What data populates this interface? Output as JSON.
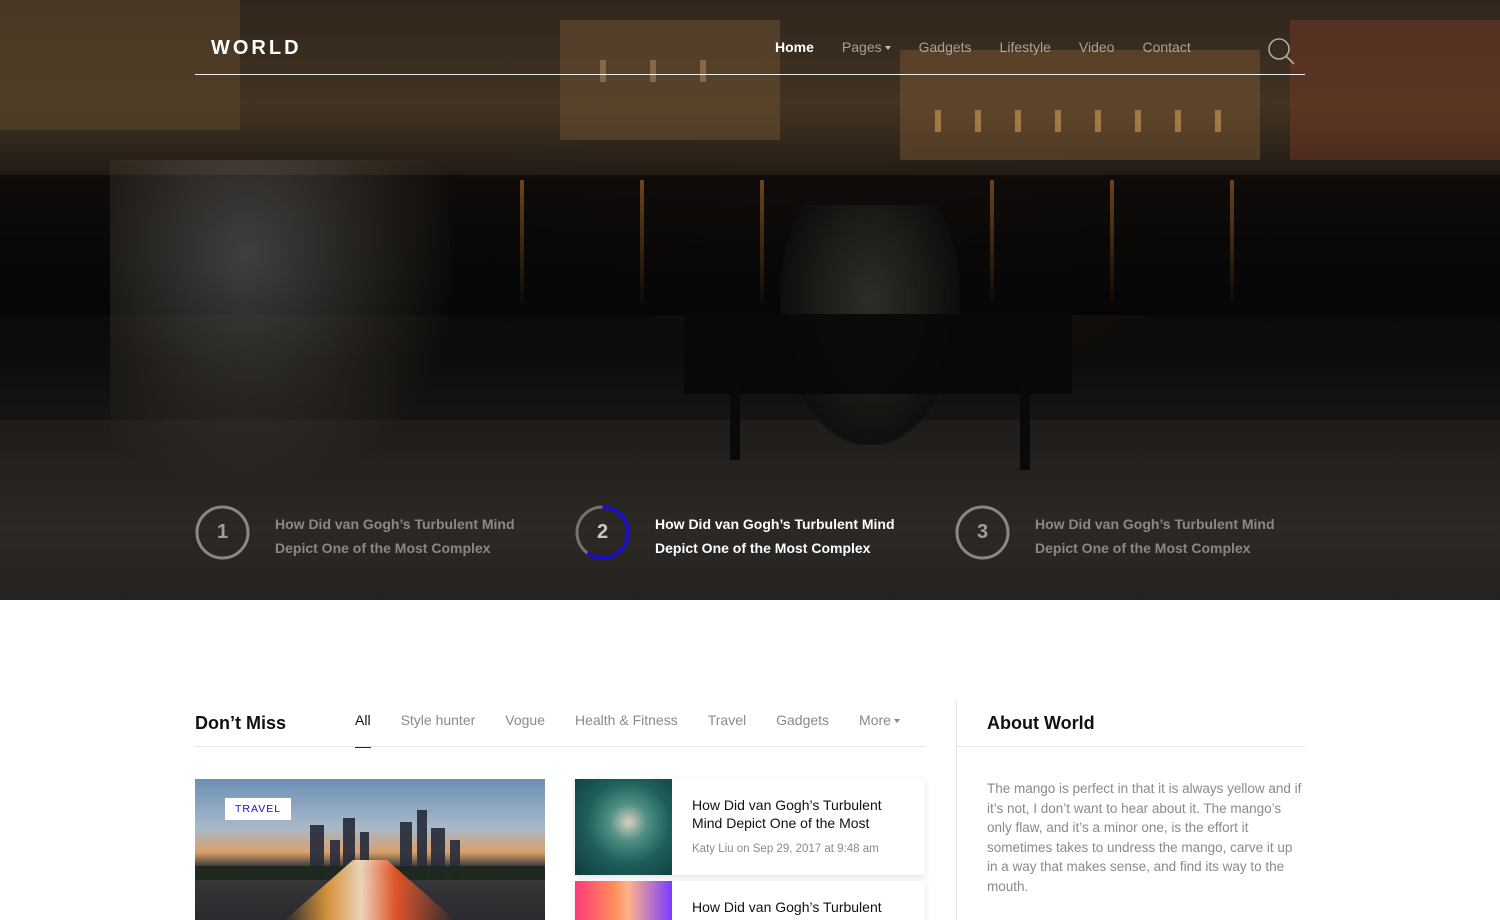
{
  "site": {
    "logo": "WORLD"
  },
  "nav": {
    "items": [
      {
        "label": "Home",
        "active": true
      },
      {
        "label": "Pages",
        "has_dropdown": true
      },
      {
        "label": "Gadgets"
      },
      {
        "label": "Lifestyle"
      },
      {
        "label": "Video"
      },
      {
        "label": "Contact"
      }
    ],
    "search_icon": "search-icon"
  },
  "hero": {
    "slides": [
      {
        "number": "1",
        "title": "How Did van Gogh’s Turbulent Mind Depict One of the Most Complex",
        "active": false
      },
      {
        "number": "2",
        "title": "How Did van Gogh’s Turbulent Mind Depict One of the Most Complex",
        "active": true,
        "progress": 0.6
      },
      {
        "number": "3",
        "title": "How Did van Gogh’s Turbulent Mind Depict One of the Most Complex",
        "active": false
      }
    ]
  },
  "dont_miss": {
    "title": "Don’t Miss",
    "tabs": [
      {
        "label": "All",
        "active": true
      },
      {
        "label": "Style hunter"
      },
      {
        "label": "Vogue"
      },
      {
        "label": "Health & Fitness"
      },
      {
        "label": "Travel"
      },
      {
        "label": "Gadgets"
      },
      {
        "label": "More",
        "has_dropdown": true
      }
    ],
    "featured": {
      "badge": "TRAVEL"
    },
    "articles": [
      {
        "title": "How Did van Gogh’s Turbulent Mind Depict One of the Most",
        "author": "Katy Liu",
        "on": "on",
        "date": "Sep 29, 2017 at 9:48 am"
      },
      {
        "title": "How Did van Gogh’s Turbulent Mind Depict One of the Most",
        "author": "",
        "on": "",
        "date": ""
      }
    ]
  },
  "about": {
    "title": "About World",
    "text": "The mango is perfect in that it is always yellow and if it’s not, I don’t want to hear about it. The mango’s only flaw, and it’s a minor one, is the effort it sometimes takes to undress the mango, carve it up in a way that makes sense, and find its way to the mouth."
  },
  "colors": {
    "accent": "#1a0dd1",
    "muted": "#8a8a8a",
    "heading": "#111111"
  }
}
